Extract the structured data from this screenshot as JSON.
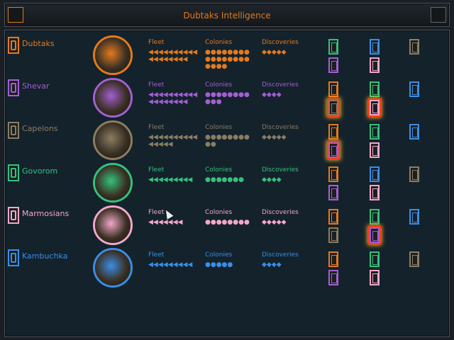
{
  "title": "Dubtaks Intelligence",
  "colors": {
    "dubtaks": "#e57a1d",
    "shevar": "#a35fd2",
    "capelons": "#8a7e62",
    "govorom": "#34c27b",
    "marmosians": "#f2a8c8",
    "kambuchka": "#3a8ee6"
  },
  "labels": {
    "fleet": "Fleet",
    "colonies": "Colonies",
    "discoveries": "Discoveries"
  },
  "races": [
    {
      "name": "Dubtaks",
      "fleet": "◀◀◀◀◀◀◀◀◀◀\n◀◀◀◀◀◀◀◀",
      "colonies": "●●●●●●●●\n●●●●●●●●\n●●●●",
      "discoveries": "◆◆◆◆◆"
    },
    {
      "name": "Shevar",
      "fleet": "◀◀◀◀◀◀◀◀◀◀\n◀◀◀◀◀◀◀◀",
      "colonies": "●●●●●●●●\n●●●",
      "discoveries": "◆◆◆◆"
    },
    {
      "name": "Capelons",
      "fleet": "◀◀◀◀◀◀◀◀◀◀\n◀◀◀◀◀",
      "colonies": "●●●●●●●●\n●●",
      "discoveries": "◆◆◆◆◆"
    },
    {
      "name": "Govorom",
      "fleet": "◀◀◀◀◀◀◀◀◀",
      "colonies": "●●●●●●●",
      "discoveries": "◆◆◆◆"
    },
    {
      "name": "Marmosians",
      "fleet": "◀◀◀◀◀◀◀",
      "colonies": "●●●●●●●●",
      "discoveries": "◆◆◆◆◆"
    },
    {
      "name": "Kambuchka",
      "fleet": "◀◀◀◀◀◀◀◀◀",
      "colonies": "●●●●●",
      "discoveries": "◆◆◆◆"
    }
  ],
  "relations": [
    [
      {
        "race": "govorom"
      },
      {
        "race": "kambuchka"
      },
      {
        "race": "capelons"
      },
      {
        "race": "shevar"
      },
      {
        "race": "marmosians"
      }
    ],
    [
      {
        "race": "dubtaks"
      },
      {
        "race": "govorom"
      },
      {
        "race": "kambuchka"
      },
      {
        "race": "capelons",
        "war": true
      },
      {
        "race": "marmosians",
        "war": true
      }
    ],
    [
      {
        "race": "dubtaks"
      },
      {
        "race": "govorom"
      },
      {
        "race": "kambuchka"
      },
      {
        "race": "shevar",
        "war": true
      },
      {
        "race": "marmosians"
      }
    ],
    [
      {
        "race": "dubtaks"
      },
      {
        "race": "kambuchka"
      },
      {
        "race": "capelons"
      },
      {
        "race": "shevar"
      },
      {
        "race": "marmosians"
      }
    ],
    [
      {
        "race": "dubtaks"
      },
      {
        "race": "govorom"
      },
      {
        "race": "kambuchka"
      },
      {
        "race": "capelons"
      },
      {
        "race": "shevar",
        "war": true
      }
    ],
    [
      {
        "race": "dubtaks"
      },
      {
        "race": "govorom"
      },
      {
        "race": "capelons"
      },
      {
        "race": "shevar"
      },
      {
        "race": "marmosians"
      }
    ]
  ]
}
